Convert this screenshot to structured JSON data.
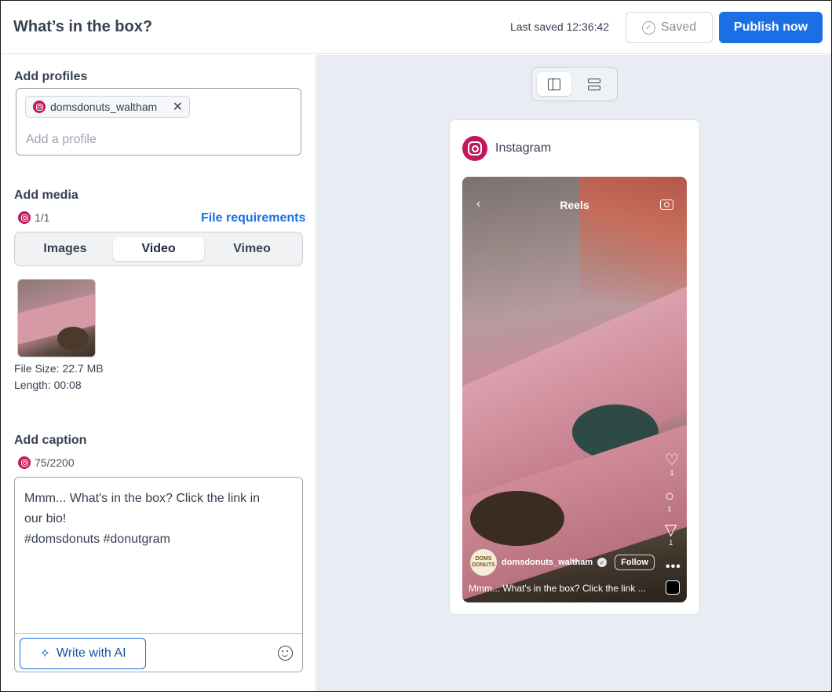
{
  "header": {
    "title": "What’s in the box?",
    "last_saved": "Last saved 12:36:42",
    "saved_label": "Saved",
    "publish_label": "Publish now"
  },
  "profiles": {
    "section_label": "Add profiles",
    "chips": [
      {
        "name": "domsdonuts_waltham",
        "network": "instagram-icon"
      }
    ],
    "placeholder": "Add a profile"
  },
  "media": {
    "section_label": "Add media",
    "count": "1/1",
    "file_requirements": "File requirements",
    "tabs": [
      {
        "label": "Images",
        "active": false
      },
      {
        "label": "Video",
        "active": true
      },
      {
        "label": "Vimeo",
        "active": false
      }
    ],
    "file_size": "File Size: 22.7 MB",
    "length": "Length: 00:08"
  },
  "caption": {
    "section_label": "Add caption",
    "count": "75/2200",
    "text": "Mmm... What's in the box? Click the link in\nour bio!\n#domsdonuts #donutgram",
    "ai_button": "Write with AI"
  },
  "preview": {
    "network": "Instagram",
    "reel_title": "Reels",
    "likes": "1",
    "comments": "1",
    "shares": "1",
    "username": "domsdonuts_waltham",
    "follow_label": "Follow",
    "logo_text": "DOMS DONUTS",
    "caption": "Mmm... What's in the box? Click the link ...",
    "more": "•••"
  },
  "colors": {
    "accent": "#1a6fe5",
    "instagram": "#c2185b",
    "preview_bg": "#e9edf3"
  }
}
